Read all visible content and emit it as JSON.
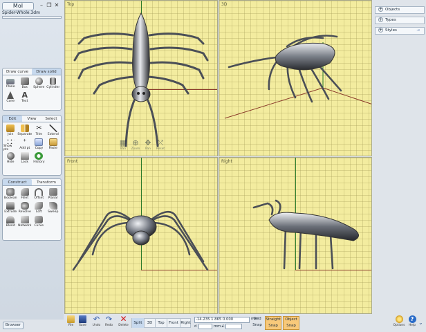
{
  "app": {
    "title": "MoI",
    "filename": "Spider-Whole.3dm"
  },
  "palette1": {
    "tabs": [
      "Draw curve",
      "Draw solid"
    ],
    "tools": [
      "Plane",
      "Box",
      "Sphere",
      "Cylinder",
      "Cone",
      "Text"
    ]
  },
  "palette2": {
    "tabs": [
      "Edit",
      "View",
      "Select"
    ],
    "tools": [
      "Join",
      "Separate",
      "Trim",
      "Extend",
      "Show pts",
      "Add pt",
      "Copy",
      "Paste",
      "Hide",
      "Lock",
      "History"
    ]
  },
  "palette3": {
    "tabs": [
      "Construct",
      "Transform"
    ],
    "tools": [
      "Boolean",
      "Fillet",
      "Offset",
      "Planar",
      "Extrude",
      "Revolve",
      "Loft",
      "Sweep",
      "Blend",
      "Network",
      "Curve"
    ]
  },
  "viewports": {
    "top": "Top",
    "persp": "3D",
    "front": "Front",
    "right": "Right"
  },
  "nav": {
    "labels": [
      "Pan",
      "Zoom",
      "Pan",
      "Reset"
    ]
  },
  "right_panel": {
    "items": [
      "Objects",
      "Types",
      "Styles"
    ]
  },
  "bottom": {
    "browser": "Browser",
    "buttons": [
      "File",
      "Save",
      "Undo",
      "Redo",
      "Delete"
    ],
    "views": [
      "Split",
      "3D",
      "Top",
      "Front",
      "Right"
    ],
    "coord_xyz": "-14.235  1.865  0.000",
    "unit": "mm",
    "d_label": "d",
    "mm2": "mm",
    "angle_label": "∠",
    "grid_snap": "Grid Snap",
    "straight_snap": "Straight Snap",
    "object_snap": "Object Snap",
    "options": "Options",
    "help": "Help"
  },
  "colors": {
    "viewport": "#f3ec9f",
    "snap_active": "#f8c97a",
    "tab_active": "#c7d9ee"
  }
}
